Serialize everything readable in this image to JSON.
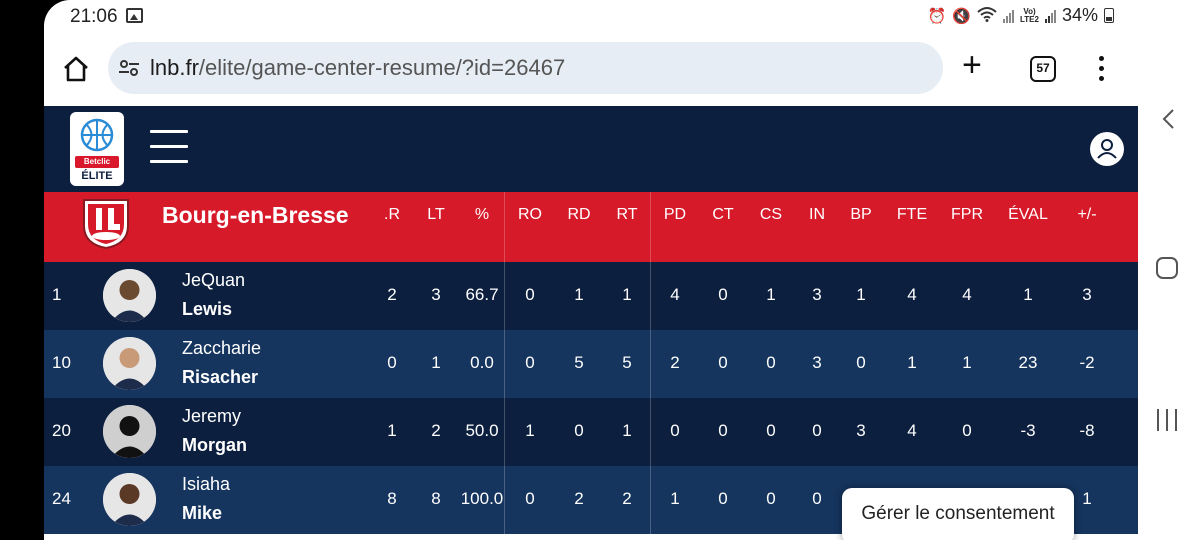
{
  "status_bar": {
    "time": "21:06",
    "network": "LTE2",
    "battery": "34%"
  },
  "browser": {
    "url_host": "lnb.fr",
    "url_path": "/elite/game-center-resume/?id=26467",
    "tab_count": "57"
  },
  "site": {
    "logo_brand": "Betclic",
    "logo_league": "ÉLITE"
  },
  "team": {
    "name": "Bourg-en-Bresse"
  },
  "columns": [
    ".R",
    "LT",
    "%",
    "RO",
    "RD",
    "RT",
    "PD",
    "CT",
    "CS",
    "IN",
    "BP",
    "FTE",
    "FPR",
    "ÉVAL",
    "+/-"
  ],
  "players": [
    {
      "number": "1",
      "first": "JeQuan",
      "last": "Lewis",
      "stats": [
        "2",
        "3",
        "66.7",
        "0",
        "1",
        "1",
        "4",
        "0",
        "1",
        "3",
        "1",
        "4",
        "4",
        "1",
        "3"
      ]
    },
    {
      "number": "10",
      "first": "Zaccharie",
      "last": "Risacher",
      "stats": [
        "0",
        "1",
        "0.0",
        "0",
        "5",
        "5",
        "2",
        "0",
        "0",
        "3",
        "0",
        "1",
        "1",
        "23",
        "-2"
      ]
    },
    {
      "number": "20",
      "first": "Jeremy",
      "last": "Morgan",
      "stats": [
        "1",
        "2",
        "50.0",
        "1",
        "0",
        "1",
        "0",
        "0",
        "0",
        "0",
        "3",
        "4",
        "0",
        "-3",
        "-8"
      ]
    },
    {
      "number": "24",
      "first": "Isiaha",
      "last": "Mike",
      "stats": [
        "8",
        "8",
        "100.0",
        "0",
        "2",
        "2",
        "1",
        "0",
        "0",
        "0",
        "",
        "",
        "",
        "",
        "1"
      ]
    }
  ],
  "consent": {
    "label": "Gérer le consentement"
  },
  "colors": {
    "header_navy": "#0c1f3f",
    "team_red": "#d61a2a",
    "row_light": "#15345e"
  }
}
